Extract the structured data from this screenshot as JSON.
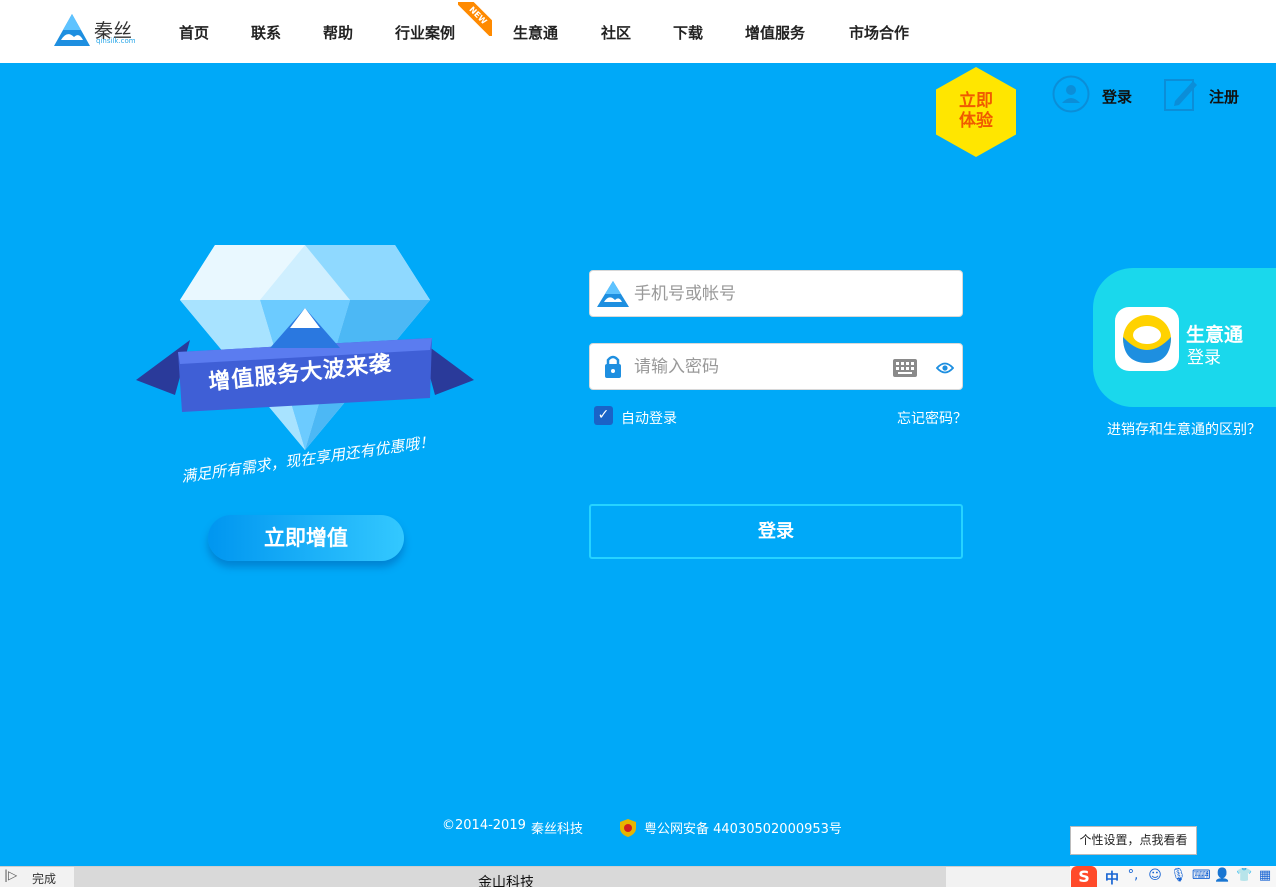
{
  "logo": {
    "name": "秦丝",
    "sub": "qinsilk.com"
  },
  "nav": {
    "items": [
      {
        "label": "首页"
      },
      {
        "label": "联系"
      },
      {
        "label": "帮助"
      },
      {
        "label": "行业案例"
      },
      {
        "label": "生意通"
      },
      {
        "label": "社区"
      },
      {
        "label": "下载"
      },
      {
        "label": "增值服务"
      },
      {
        "label": "市场合作"
      }
    ],
    "new_badge": "NEW"
  },
  "try_now": {
    "line1": "立即",
    "line2": "体验"
  },
  "account": {
    "login_label": "登录",
    "register_label": "注册"
  },
  "promo": {
    "banner": "增值服务大波来袭",
    "slogan": "满足所有需求，现在享用还有优惠哦！",
    "button": "立即增值"
  },
  "form": {
    "account_placeholder": "手机号或帐号",
    "account_value": "",
    "password_placeholder": "请输入密码",
    "password_value": "",
    "remember_checked": true,
    "remember_label": "自动登录",
    "forgot_label": "忘记密码？",
    "submit_label": "登录"
  },
  "side": {
    "title": "生意通",
    "sub": "登录",
    "diff_link": "进销存和生意通的区别？"
  },
  "footer": {
    "copyright": "©2014-2019",
    "company": "秦丝科技",
    "icp": "粤公网安备 44030502000953号"
  },
  "tooltip": "个性设置，点我看看",
  "statusbar": {
    "status": "完成",
    "window_title": "金山科技"
  },
  "ime": {
    "mode": "中",
    "logo": "S"
  },
  "colors": {
    "background": "#00a9f8",
    "accent_yellow": "#ffe600",
    "try_text": "#f05a00",
    "side_card": "#1ad8ec",
    "checkbox": "#1a63c7"
  }
}
